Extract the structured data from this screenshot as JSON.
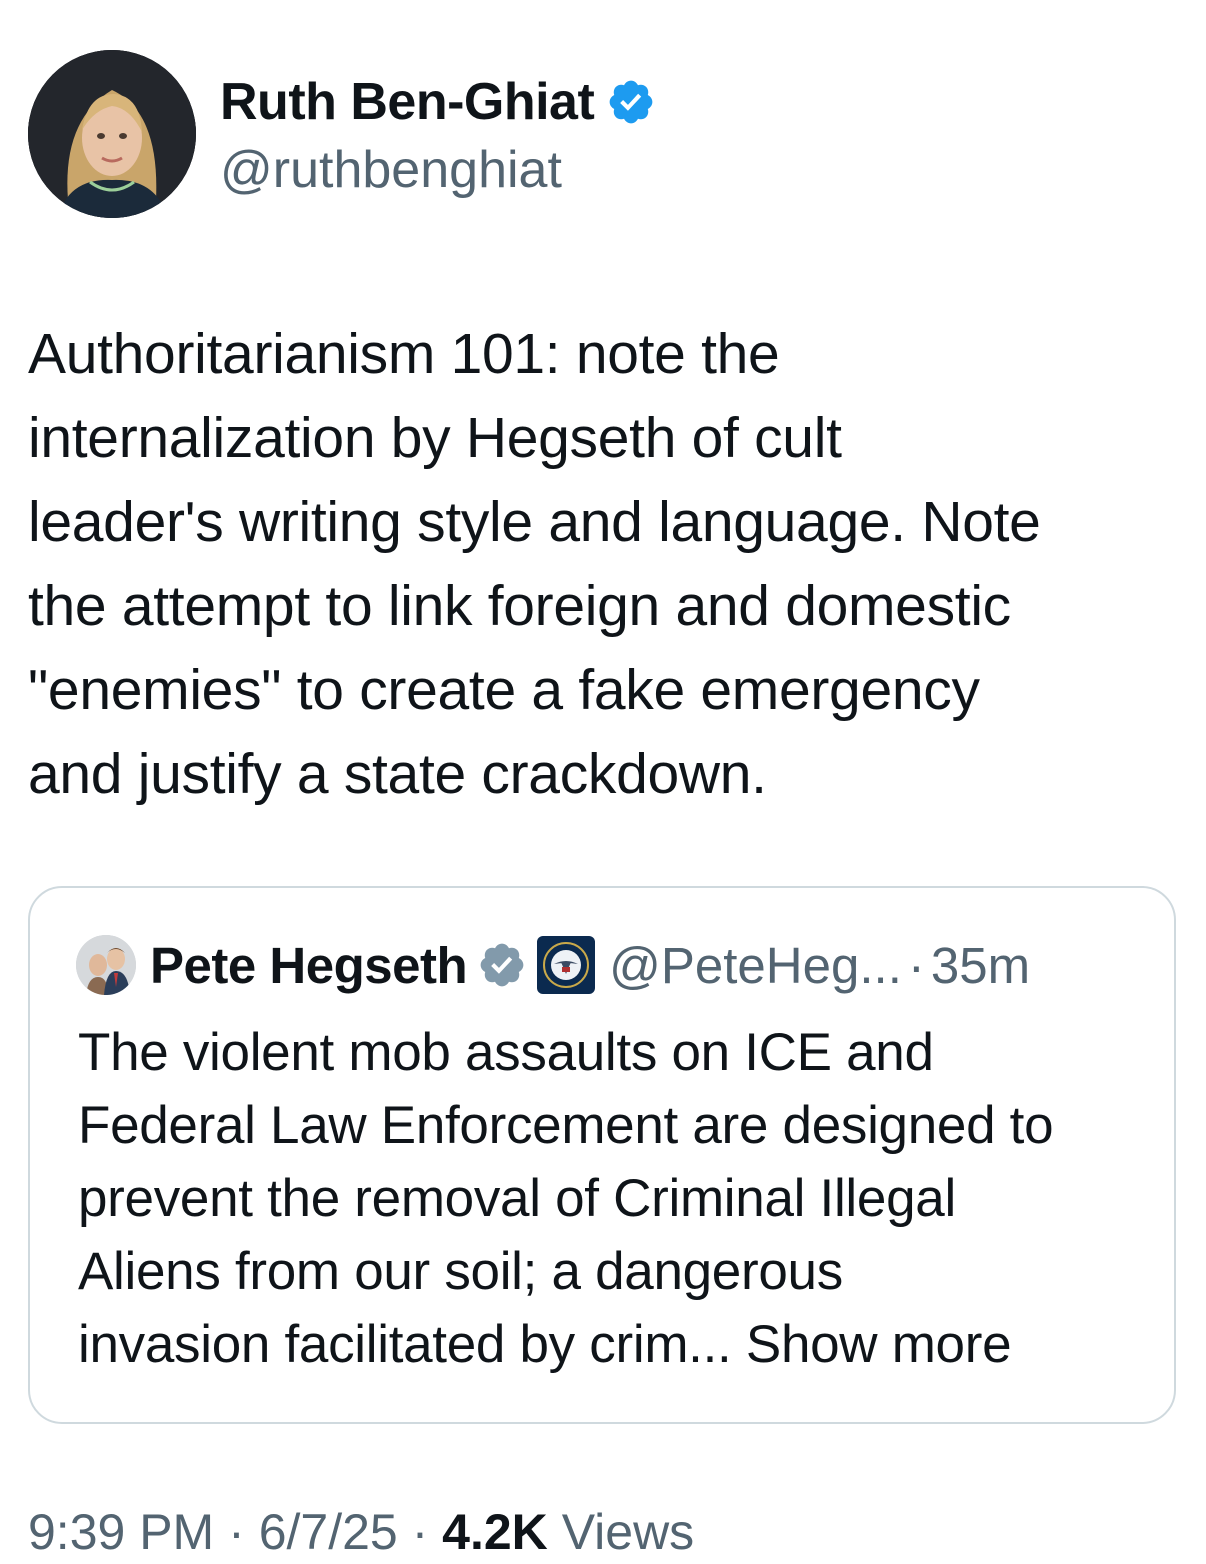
{
  "author": {
    "display_name": "Ruth Ben-Ghiat",
    "handle": "@ruthbenghiat",
    "verified_icon": "verified-badge-icon",
    "badge_color": "#1d9bf0"
  },
  "tweet": {
    "lines": [
      "Authoritarianism 101: note the",
      "internalization by Hegseth of cult",
      "leader's writing style and language. Note",
      "the attempt to link foreign and domestic",
      "\"enemies\" to create a fake emergency",
      "and justify a state crackdown."
    ]
  },
  "quoted_tweet": {
    "display_name": "Pete Hegseth",
    "verified_icon": "gray-verified-badge-icon",
    "affiliation_icon": "department-of-defense-seal-icon",
    "handle": "@PeteHeg...",
    "separator": "·",
    "time": "35m",
    "lines": [
      "The violent mob assaults on ICE and",
      "Federal Law Enforcement are designed to",
      "prevent the removal of Criminal Illegal",
      "Aliens from our soil; a dangerous"
    ],
    "last_line": "invasion facilitated by crim...",
    "show_more": "Show more"
  },
  "footer": {
    "time": "9:39 PM",
    "separator": "·",
    "date": "6/7/25",
    "views_count": "4.2K",
    "views_label": "Views"
  },
  "colors": {
    "text": "#0f1419",
    "secondary": "#536471",
    "border": "#cfd9de",
    "accent": "#1d9bf0",
    "gray_badge": "#829aab"
  }
}
